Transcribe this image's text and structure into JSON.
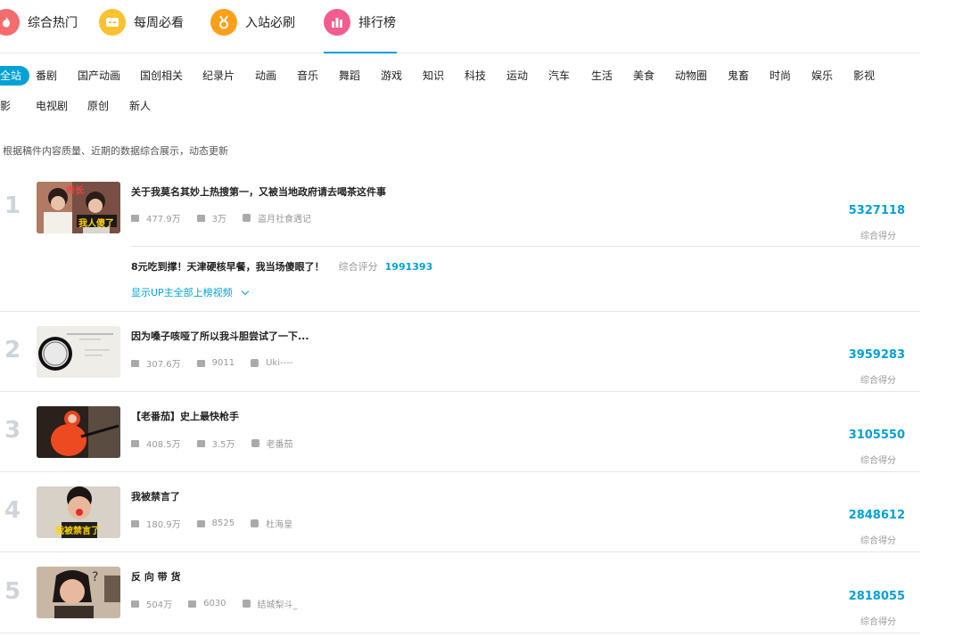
{
  "topnav": {
    "tabs": [
      {
        "label": "综合热门",
        "icon": "fire-icon",
        "color": "#f56c6c"
      },
      {
        "label": "每周必看",
        "icon": "weekly-icon",
        "color": "#f9c22e"
      },
      {
        "label": "入站必刷",
        "icon": "medal-icon",
        "color": "#ff9f1a"
      },
      {
        "label": "排行榜",
        "icon": "ranking-icon",
        "color": "#f25d8e",
        "active": true
      }
    ]
  },
  "categories": {
    "row1": [
      "全站",
      "番剧",
      "国产动画",
      "国创相关",
      "纪录片",
      "动画",
      "音乐",
      "舞蹈",
      "游戏",
      "知识",
      "科技",
      "运动",
      "汽车",
      "生活",
      "美食",
      "动物圈",
      "鬼畜",
      "时尚",
      "娱乐",
      "影视"
    ],
    "row2": [
      "电影",
      "电视剧",
      "原创",
      "新人"
    ],
    "active": "全站"
  },
  "intro": "根据稿件内容质量、近期的数据综合展示，动态更新",
  "score_label": "综合得分",
  "ranking": [
    {
      "rank": "1",
      "title": "关于我莫名其妙上热搜第一，又被当地政府请去喝茶这件事",
      "plays": "477.9万",
      "comments": "3万",
      "up": "盗月社食遇记",
      "score": "5327118",
      "related": {
        "title": "8元吃到撑！天津硬核早餐，我当场傻眼了！",
        "label": "综合评分",
        "score": "1991393"
      },
      "more": "显示UP主全部上榜视频",
      "thumb_text": [
        "市长",
        "我人傻了"
      ]
    },
    {
      "rank": "2",
      "title": "因为嗓子咳哑了所以我斗胆尝试了一下...",
      "plays": "307.6万",
      "comments": "9011",
      "up": "Uki----",
      "score": "3959283",
      "thumb_text": []
    },
    {
      "rank": "3",
      "title": "【老番茄】史上最快枪手",
      "plays": "408.5万",
      "comments": "3.5万",
      "up": "老番茄",
      "score": "3105550",
      "thumb_text": []
    },
    {
      "rank": "4",
      "title": "我被禁言了",
      "plays": "180.9万",
      "comments": "8525",
      "up": "杜海皇",
      "score": "2848612",
      "thumb_text": [
        "我被禁言了"
      ]
    },
    {
      "rank": "5",
      "title": "反 向 带 货",
      "plays": "504万",
      "comments": "6030",
      "up": "结城梨斗_",
      "score": "2818055",
      "thumb_text": []
    }
  ],
  "colors": {
    "accent": "#00a1d6",
    "rank_number": "#cfd4da"
  }
}
